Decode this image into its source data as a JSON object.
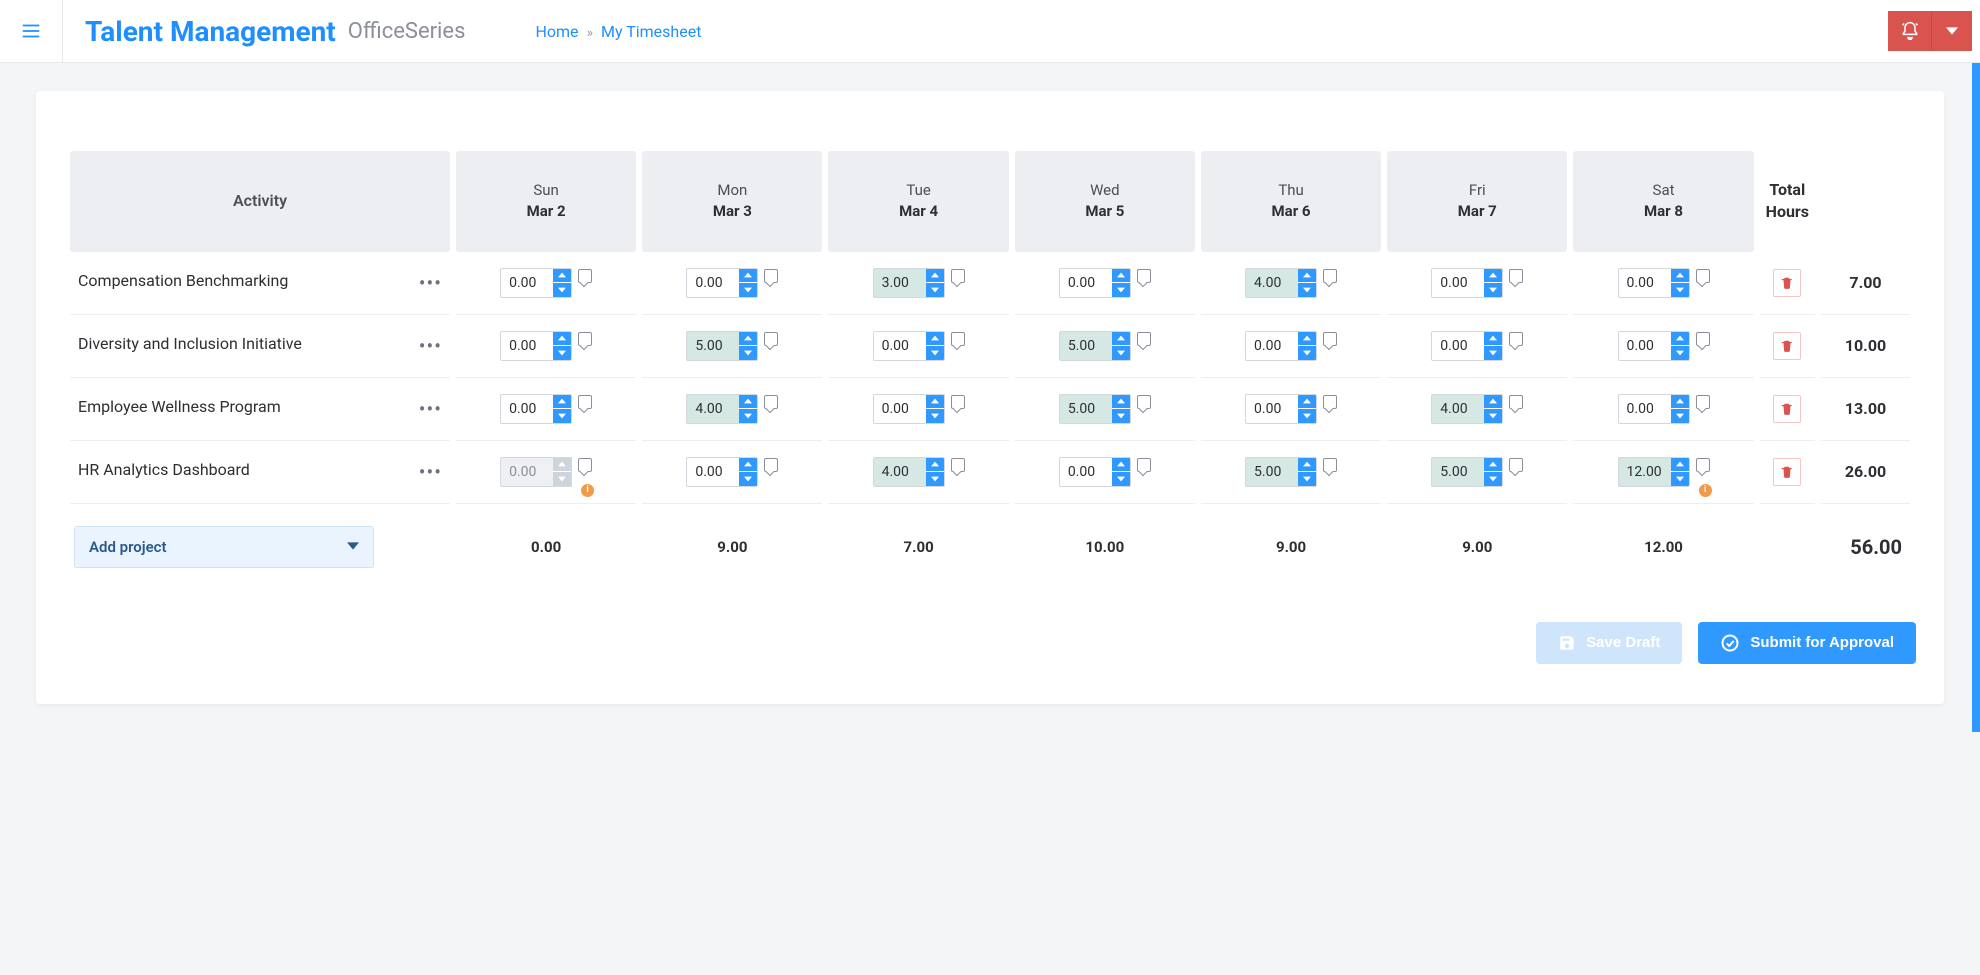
{
  "header": {
    "brand": "Talent Management",
    "brand_sub": "OfficeSeries",
    "breadcrumb_home": "Home",
    "breadcrumb_sep": "»",
    "breadcrumb_current": "My Timesheet"
  },
  "columns": {
    "activity": "Activity",
    "total": "Total Hours",
    "days": [
      {
        "name": "Sun",
        "date": "Mar 2"
      },
      {
        "name": "Mon",
        "date": "Mar 3"
      },
      {
        "name": "Tue",
        "date": "Mar 4"
      },
      {
        "name": "Wed",
        "date": "Mar 5"
      },
      {
        "name": "Thu",
        "date": "Mar 6"
      },
      {
        "name": "Fri",
        "date": "Mar 7"
      },
      {
        "name": "Sat",
        "date": "Mar 8"
      }
    ]
  },
  "rows": [
    {
      "activity": "Compensation Benchmarking",
      "hours": [
        {
          "v": "0.00",
          "filled": false
        },
        {
          "v": "0.00",
          "filled": false
        },
        {
          "v": "3.00",
          "filled": true
        },
        {
          "v": "0.00",
          "filled": false
        },
        {
          "v": "4.00",
          "filled": true
        },
        {
          "v": "0.00",
          "filled": false
        },
        {
          "v": "0.00",
          "filled": false
        }
      ],
      "total": "7.00"
    },
    {
      "activity": "Diversity and Inclusion Initiative",
      "hours": [
        {
          "v": "0.00",
          "filled": false
        },
        {
          "v": "5.00",
          "filled": true
        },
        {
          "v": "0.00",
          "filled": false
        },
        {
          "v": "5.00",
          "filled": true
        },
        {
          "v": "0.00",
          "filled": false
        },
        {
          "v": "0.00",
          "filled": false
        },
        {
          "v": "0.00",
          "filled": false
        }
      ],
      "total": "10.00"
    },
    {
      "activity": "Employee Wellness Program",
      "hours": [
        {
          "v": "0.00",
          "filled": false
        },
        {
          "v": "4.00",
          "filled": true
        },
        {
          "v": "0.00",
          "filled": false
        },
        {
          "v": "5.00",
          "filled": true
        },
        {
          "v": "0.00",
          "filled": false
        },
        {
          "v": "4.00",
          "filled": true
        },
        {
          "v": "0.00",
          "filled": false
        }
      ],
      "total": "13.00"
    },
    {
      "activity": "HR Analytics Dashboard",
      "hours": [
        {
          "v": "0.00",
          "filled": false,
          "locked": true,
          "warn": true
        },
        {
          "v": "0.00",
          "filled": false
        },
        {
          "v": "4.00",
          "filled": true
        },
        {
          "v": "0.00",
          "filled": false
        },
        {
          "v": "5.00",
          "filled": true
        },
        {
          "v": "5.00",
          "filled": true
        },
        {
          "v": "12.00",
          "filled": true,
          "warn": true
        }
      ],
      "total": "26.00"
    }
  ],
  "footer": {
    "add_project": "Add project",
    "day_totals": [
      "0.00",
      "9.00",
      "7.00",
      "10.00",
      "9.00",
      "9.00",
      "12.00"
    ],
    "grand_total": "56.00"
  },
  "actions": {
    "save": "Save Draft",
    "submit": "Submit for Approval"
  }
}
